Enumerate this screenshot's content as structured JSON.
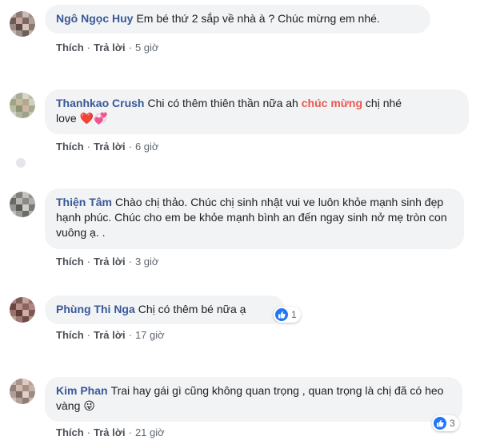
{
  "colors": {
    "name": "#385898",
    "highlight": "#e9584e",
    "bubble": "#f2f3f5",
    "like": "#2078f4"
  },
  "comments": [
    {
      "author": "Ngô Ngọc Huy",
      "text": "Em bé thứ 2 sắp về nhà à ? Chúc mừng em nhé.",
      "like_label": "Thích",
      "reply_label": "Trả lời",
      "time": "5 giờ"
    },
    {
      "author": "Thanhkao Crush",
      "text_before": "Chi có thêm thiên thần nữa ah",
      "text_highlight": "chúc mừng",
      "text_after": "chị nhé",
      "line2": "love",
      "emoji": "❤️💞",
      "like_label": "Thích",
      "reply_label": "Trả lời",
      "time": "6 giờ"
    },
    {
      "author": "Thiện Tâm",
      "text": "Chào chị thảo. Chúc chị sinh nhật vui ve luôn khỏe mạnh sinh đẹp hạnh phúc. Chúc cho em be khỏe mạnh bình an đến ngay sinh nở mẹ tròn con vuông ạ. .",
      "like_label": "Thích",
      "reply_label": "Trả lời",
      "time": "3 giờ"
    },
    {
      "author": "Phùng Thi Nga",
      "text": "Chị có thêm bé nữa ạ",
      "reaction_count": "1",
      "like_label": "Thích",
      "reply_label": "Trả lời",
      "time": "17 giờ"
    },
    {
      "author": "Kim Phan",
      "text": "Trai hay gái gì cũng không quan trọng , quan trọng là chị đã có heo vàng",
      "emoji": "😜",
      "reaction_count": "3",
      "like_label": "Thích",
      "reply_label": "Trả lời",
      "time": "21 giờ"
    }
  ]
}
